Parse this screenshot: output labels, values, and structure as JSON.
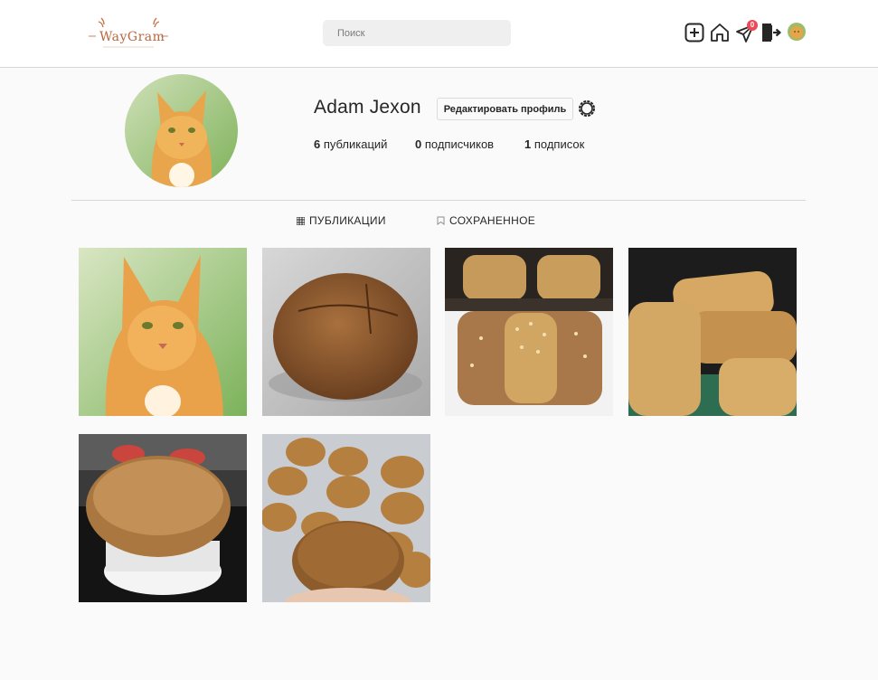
{
  "header": {
    "logo_text": "WayGram",
    "search_placeholder": "Поиск",
    "notification_count": "0"
  },
  "icons": {
    "add": "plus-square-icon",
    "home": "home-icon",
    "direct": "paper-plane-icon",
    "logout": "logout-icon",
    "settings": "gear-icon"
  },
  "profile": {
    "username": "Adam Jexon",
    "edit_label": "Редактировать профиль",
    "stats": [
      {
        "count": "6",
        "label": "публикаций"
      },
      {
        "count": "0",
        "label": "подписчиков"
      },
      {
        "count": "1",
        "label": "подписок"
      }
    ]
  },
  "tabs": [
    {
      "label": "ПУБЛИКАЦИИ",
      "icon": "grid-icon"
    },
    {
      "label": "СОХРАНЕННОЕ",
      "icon": "bookmark-icon"
    }
  ],
  "posts": [
    {
      "subject": "orange-cat"
    },
    {
      "subject": "round-rye-bread"
    },
    {
      "subject": "seeded-loaves"
    },
    {
      "subject": "white-bread-loaves"
    },
    {
      "subject": "round-bread-on-mold"
    },
    {
      "subject": "seeded-buns"
    }
  ],
  "colors": {
    "background": "#fafafa",
    "header_bg": "#ffffff",
    "badge": "#ed4956",
    "logo": "#b8683f",
    "text": "#262626"
  }
}
